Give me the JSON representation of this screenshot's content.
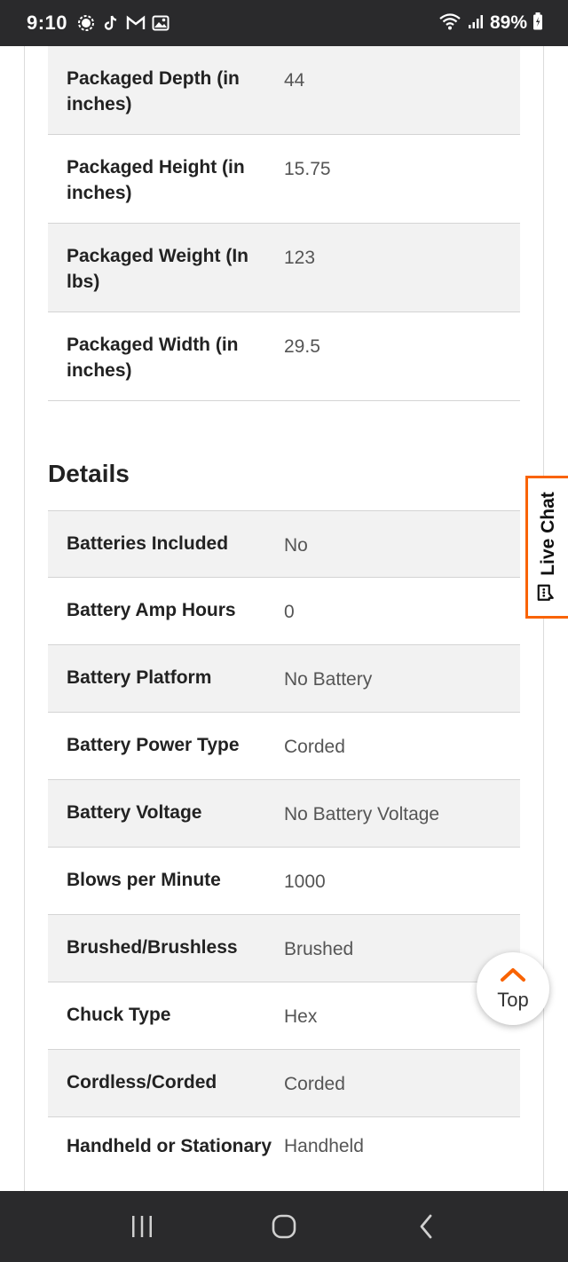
{
  "status_bar": {
    "time": "9:10",
    "battery": "89%",
    "icons_left": [
      "signal-app-icon",
      "tiktok-icon",
      "gmail-icon",
      "gallery-icon"
    ],
    "icons_right": [
      "wifi-icon",
      "cell-signal-icon",
      "battery-icon"
    ]
  },
  "packaged": [
    {
      "label": "Packaged Depth (in inches)",
      "value": "44"
    },
    {
      "label": "Packaged Height (in inches)",
      "value": "15.75"
    },
    {
      "label": "Packaged Weight (In lbs)",
      "value": "123"
    },
    {
      "label": "Packaged Width (in inches)",
      "value": "29.5"
    }
  ],
  "details": {
    "title": "Details",
    "rows": [
      {
        "label": "Batteries Included",
        "value": "No"
      },
      {
        "label": "Battery Amp Hours",
        "value": "0"
      },
      {
        "label": "Battery Platform",
        "value": "No Battery"
      },
      {
        "label": "Battery Power Type",
        "value": "Corded"
      },
      {
        "label": "Battery Voltage",
        "value": "No Battery Voltage"
      },
      {
        "label": "Blows per Minute",
        "value": "1000"
      },
      {
        "label": "Brushed/Brushless",
        "value": "Brushed"
      },
      {
        "label": "Chuck Type",
        "value": "Hex"
      },
      {
        "label": "Cordless/Corded",
        "value": "Corded"
      },
      {
        "label": "Handheld or Stationary",
        "value": "Handheld"
      }
    ]
  },
  "live_chat": {
    "label": "Live Chat",
    "accent": "#f96302"
  },
  "top_button": {
    "label": "Top",
    "accent": "#f96302"
  },
  "nav_bar": {
    "icons": [
      "recent-apps-icon",
      "home-icon",
      "back-icon"
    ]
  }
}
